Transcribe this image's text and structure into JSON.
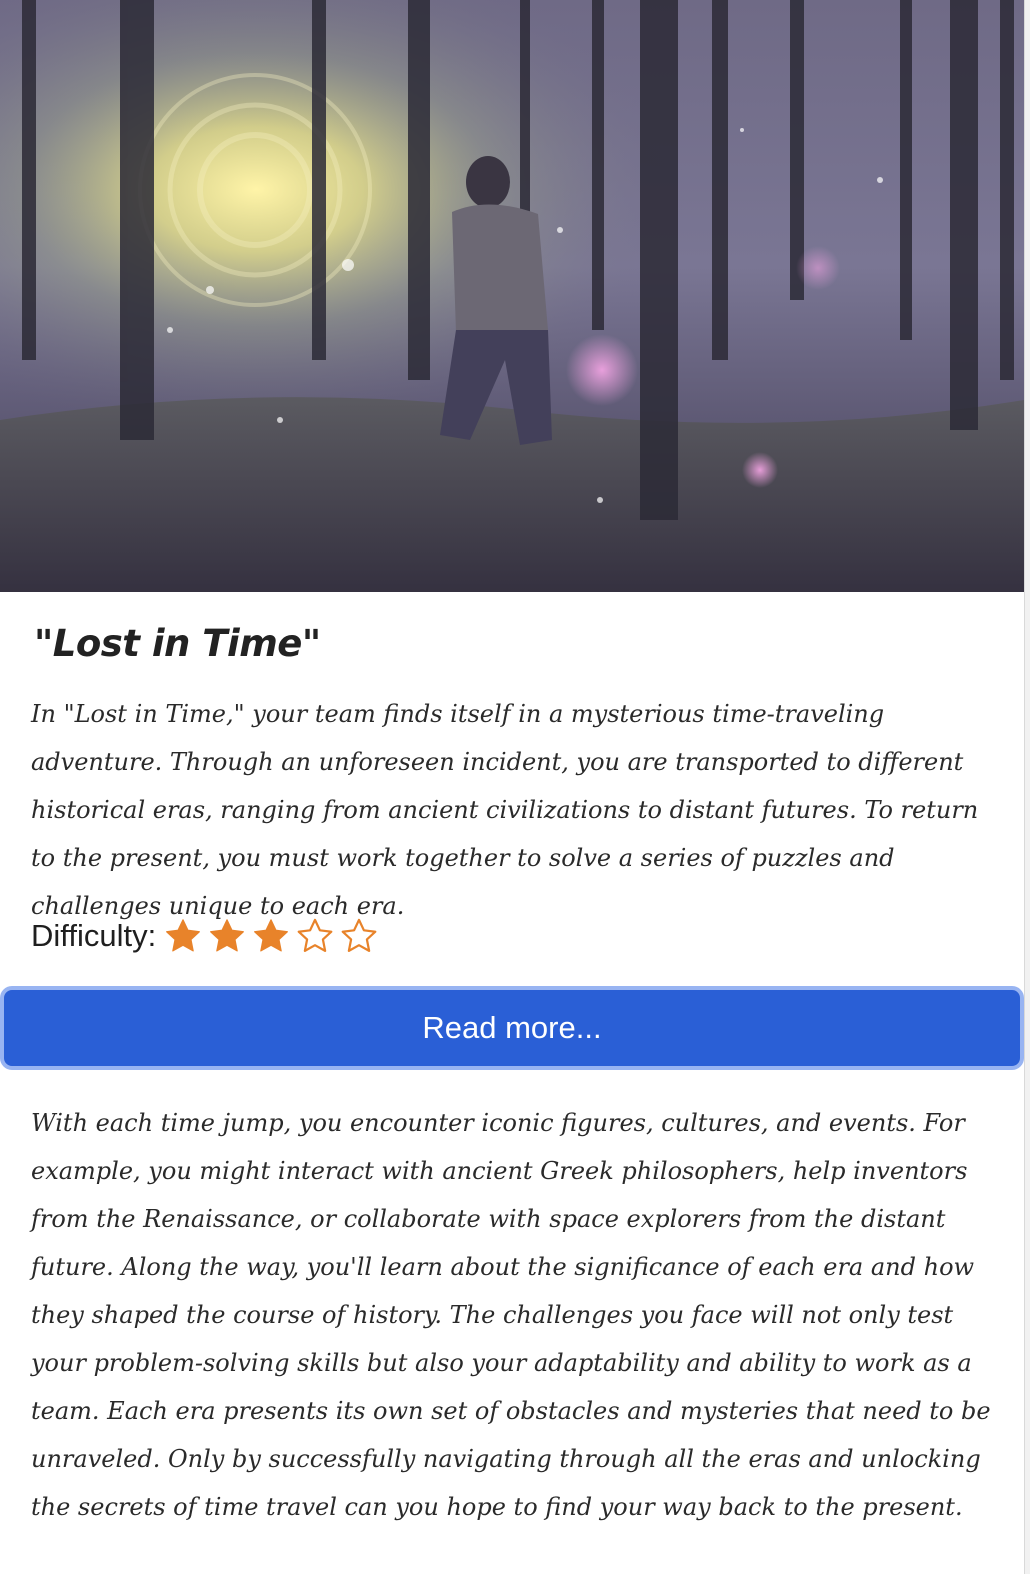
{
  "hero": {
    "image_name": "mysterious-forest-portal-image"
  },
  "title": "\"Lost in Time\"",
  "intro_text": "In \"Lost in Time,\" your team finds itself in a mysterious time-traveling adventure. Through an unforeseen incident, you are transported to different historical eras, ranging from ancient civilizations to distant futures. To return to the present, you must work together to solve a series of puzzles and challenges unique to each era.",
  "difficulty": {
    "label": "Difficulty:",
    "rating": 3,
    "max": 5,
    "star_color": "#e8832a"
  },
  "read_more_label": "Read more...",
  "more_text": "With each time jump, you encounter iconic figures, cultures, and events. For example, you might interact with ancient Greek philosophers, help inventors from the Renaissance, or collaborate with space explorers from the distant future. Along the way, you'll learn about the significance of each era and how they shaped the course of history. The challenges you face will not only test your problem-solving skills but also your adaptability and ability to work as a team. Each era presents its own set of obstacles and mysteries that need to be unraveled. Only by successfully navigating through all the eras and unlocking the secrets of time travel can you hope to find your way back to the present."
}
